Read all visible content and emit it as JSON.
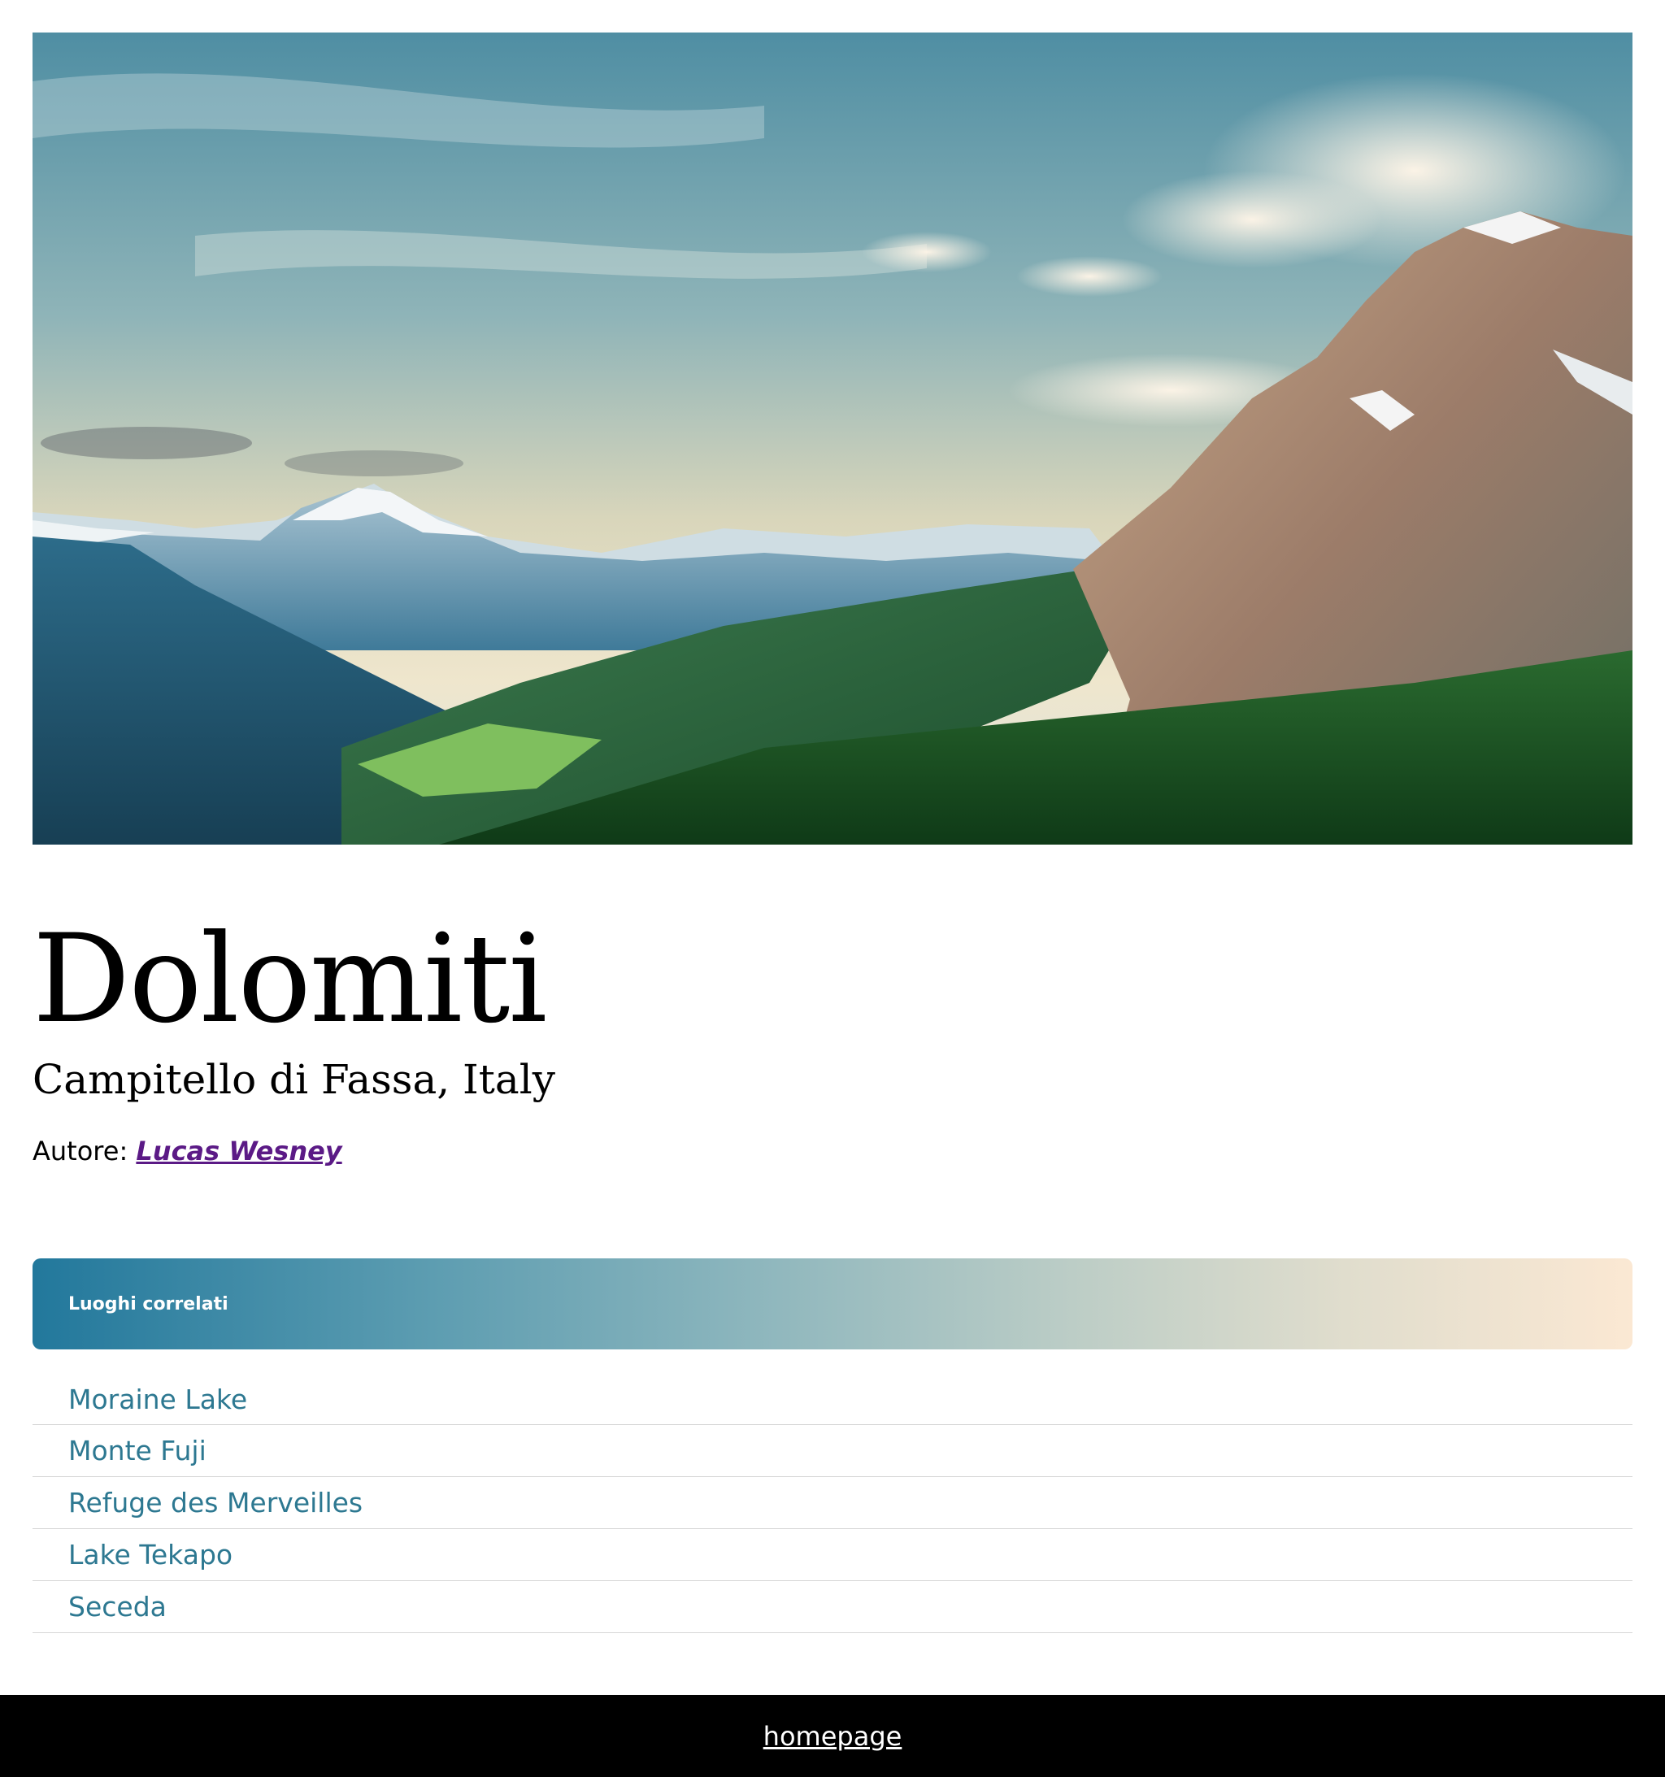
{
  "hero": {
    "alt": "Dolomiti"
  },
  "place": {
    "name": "Dolomiti",
    "location": "Campitello di Fassa, Italy"
  },
  "author": {
    "label": "Autore:",
    "name": "Lucas Wesney"
  },
  "related": {
    "heading": "Luoghi correlati",
    "items": [
      {
        "label": "Moraine Lake"
      },
      {
        "label": "Monte Fuji"
      },
      {
        "label": "Refuge des Merveilles"
      },
      {
        "label": "Lake Tekapo"
      },
      {
        "label": "Seceda"
      }
    ]
  },
  "footer": {
    "link": "homepage"
  },
  "colors": {
    "author_link": "#5b1a86",
    "related_link": "#2d7891",
    "gradient_start": "#22789c",
    "gradient_end": "#fbe8d3",
    "footer_bg": "#000000"
  }
}
